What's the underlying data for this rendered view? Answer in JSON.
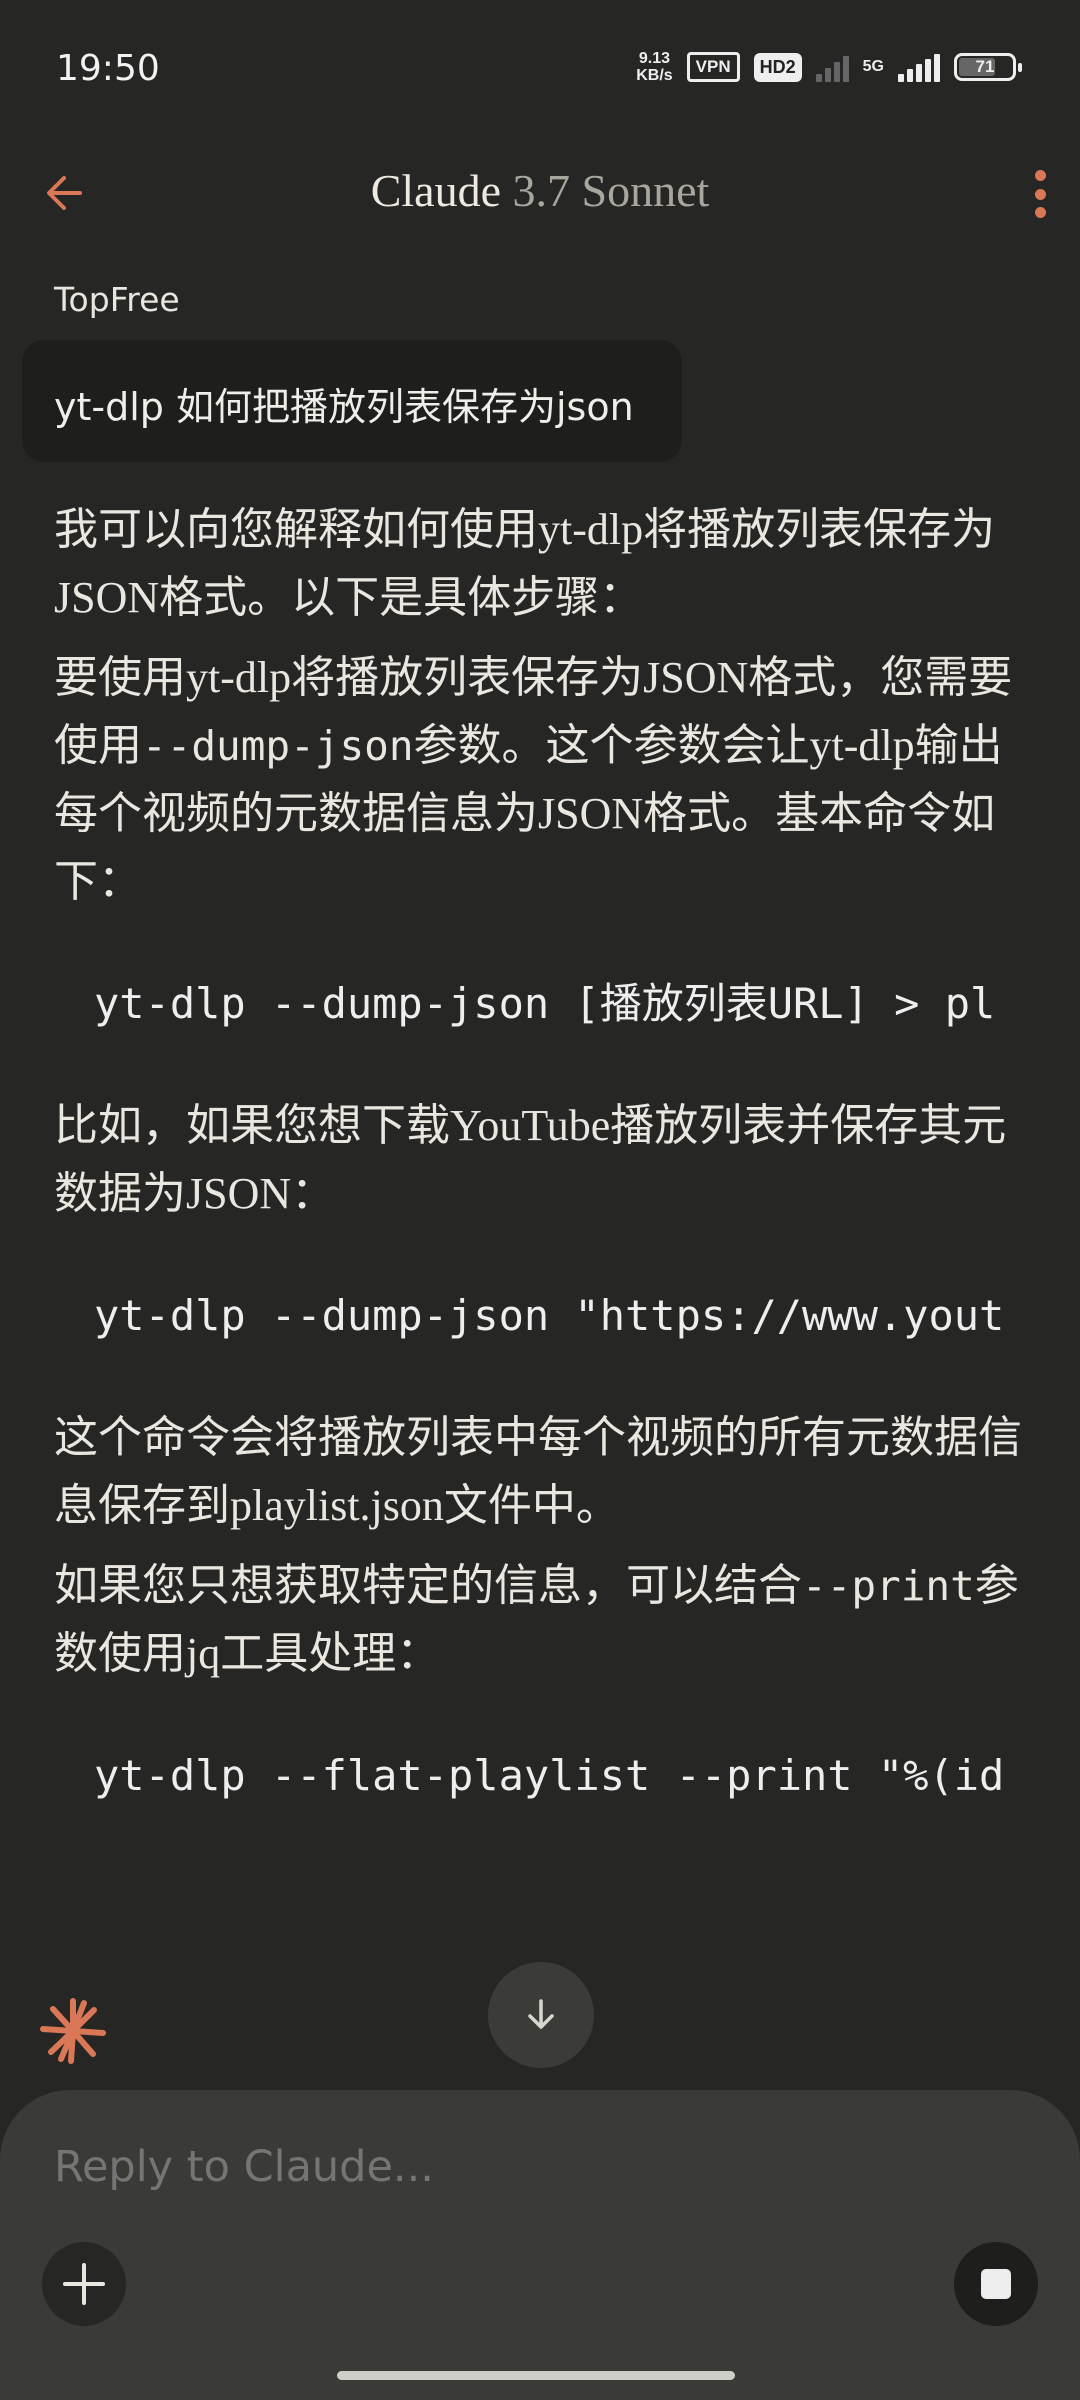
{
  "status": {
    "time": "19:50",
    "speed_value": "9.13",
    "speed_unit": "KB/s",
    "vpn": "VPN",
    "hd": "HD2",
    "network": "5G",
    "battery": "71"
  },
  "header": {
    "app": "Claude",
    "model": "3.7 Sonnet"
  },
  "user": {
    "name": "TopFree",
    "message": "yt-dlp 如何把播放列表保存为json"
  },
  "reply": {
    "p1": "我可以向您解释如何使用yt-dlp将播放列表保存为JSON格式。以下是具体步骤：",
    "p2a": "要使用yt-dlp将播放列表保存为JSON格式，您需要使用",
    "p2code": "--dump-json",
    "p2b": "参数。这个参数会让yt-dlp输出每个视频的元数据信息为JSON格式。基本命令如下：",
    "code1": "yt-dlp --dump-json [播放列表URL] > pl",
    "p3": "比如，如果您想下载YouTube播放列表并保存其元数据为JSON：",
    "code2": "yt-dlp --dump-json \"https://www.yout",
    "p4": "这个命令会将播放列表中每个视频的所有元数据信息保存到playlist.json文件中。",
    "p5a": "如果您只想获取特定的信息，可以结合",
    "p5code": "--print",
    "p5b": "参数使用jq工具处理：",
    "code3": "yt-dlp --flat-playlist --print \"%(id"
  },
  "composer": {
    "placeholder": "Reply to Claude..."
  },
  "colors": {
    "accent": "#d97757",
    "background": "#262624"
  }
}
